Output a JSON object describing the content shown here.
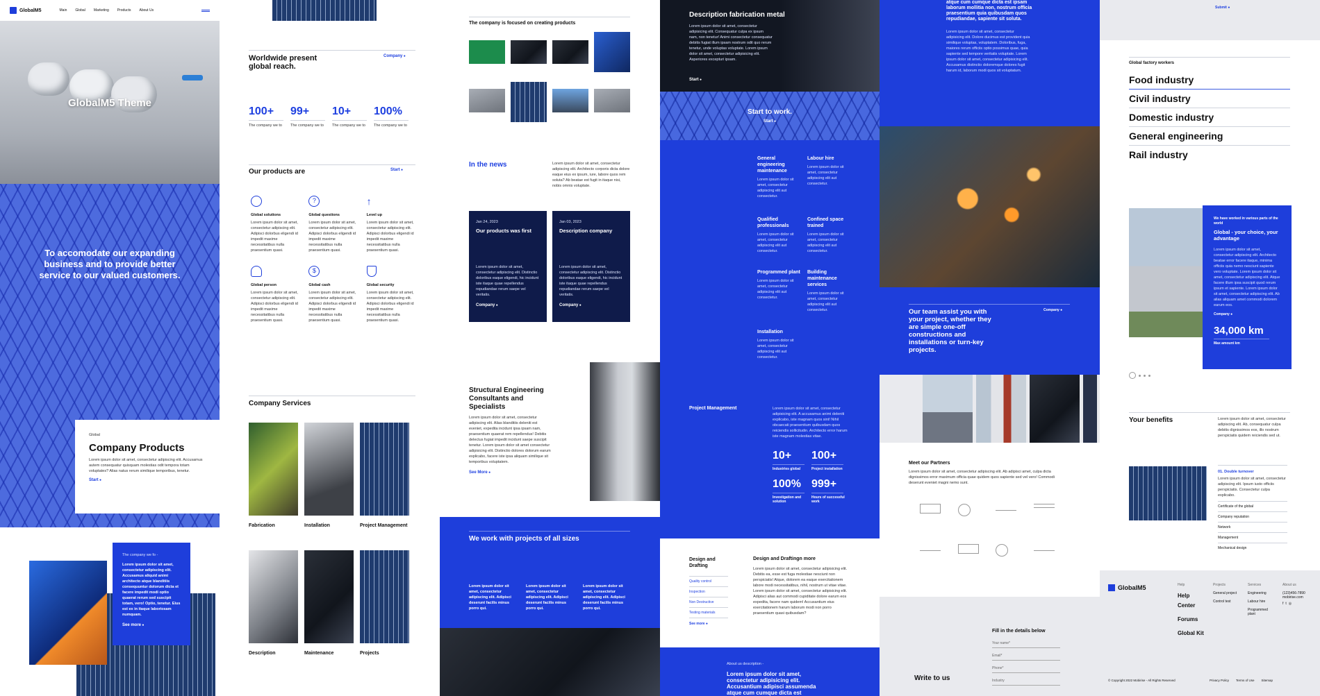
{
  "brand": "GlobalM5",
  "nav": [
    "Main",
    "Global",
    "Marketing",
    "Products",
    "About Us"
  ],
  "col1": {
    "hero_title": "GlobalM5 Theme",
    "tower_text": "To accomodate our expanding business and to provide better service to our valued customers.",
    "card_kicker": "Global",
    "card_title": "Company Products",
    "card_body": "Lorem ipsum dolor sit amet, consectetur adipiscing elit. Accusamus autem consequatur quisquam molestias odit tempora totam voluptates? Alias natus rerum similique temporibus, tenetur.",
    "card_link": "Start",
    "blue_kicker": "The company we fo -",
    "blue_body": "Lorem ipsum dolor sit amet, consectetur adipiscing elit. Accusamus aliquid animi architecto atque blanditiis consequuntur dolorum dicta et facere impedit modi optio quaerat rerum sed suscipit totam, vero! Optio, tenetur. Eius est ex in itaque laboriosam numquam.",
    "blue_link": "See more"
  },
  "col2": {
    "reach_title": "Worldwide present global reach.",
    "reach_link": "Company",
    "stats": [
      {
        "value": "100+",
        "label": "The company we to"
      },
      {
        "value": "99+",
        "label": "The company we to"
      },
      {
        "value": "10+",
        "label": "The company we to"
      },
      {
        "value": "100%",
        "label": "The company we to"
      }
    ],
    "products_title": "Our products are",
    "products_link": "Start",
    "products": [
      {
        "icon": "globe-icon",
        "title": "Global solutions"
      },
      {
        "icon": "question-icon",
        "title": "Global questions"
      },
      {
        "icon": "arrow-up-icon",
        "title": "Level up"
      },
      {
        "icon": "people-icon",
        "title": "Global person"
      },
      {
        "icon": "dollar-icon",
        "title": "Global cash"
      },
      {
        "icon": "shield-icon",
        "title": "Global security"
      }
    ],
    "product_body": "Lorem ipsum dolor sit amet, consectetur adipiscing elit. Adipisci dolorbus eligendi id impedit maxime necessitatibus nulla praesentium quasi.",
    "services_title": "Company Services",
    "services": [
      "Fabrication",
      "Installation",
      "Project Management",
      "Description",
      "Maintenance",
      "Projects"
    ]
  },
  "col3": {
    "focused_title": "The company is focused on creating products",
    "news_title": "In the news",
    "news_body": "Lorem ipsum dolor sit amet, consectetur adipiscing elit. Architecto corporis dicta dolore eaque eius ex ipsum, iure, labore quos rem soluta? Ab beatae est fugit in itaque nisi, nobis omnis voluptate.",
    "news_cards": [
      {
        "date": "Jan 24, 2023",
        "title": "Our products was first",
        "body": "Lorem ipsum dolor sit amet, consectetur adipiscing elit. Distinctio doloribus eaque eligendi, hic incidunt iste itaque quae repellendus repudiandae rerum saepe vel veritatis.",
        "link": "Company"
      },
      {
        "date": "Jan 03, 2023",
        "title": "Description company",
        "body": "Lorem ipsum dolor sit amet, consectetur adipiscing elit. Distinctio doloribus eaque eligendi, hic incidunt iste itaque quae repellendus repudiandae rerum saepe vel veritatis.",
        "link": "Company"
      }
    ],
    "struct_title": "Structural Engineering Consultants and Specialists",
    "struct_body": "Lorem ipsum dolor sit amet, consectetur adipiscing elit. Alias blanditiis deleniti est eveniet, expedita incidunt ipsa ipsam nam, praesentium quaerat rem repellendus! Debitis delectus fugiat impedit incidunt saepe suscipit tenetur. Lorem ipsum dolor sit amet consectetur adipisicing elit. Distinctio dolores dolorum earum explicabo, facere iste ipsa aliquam similique sit temporibus voluptatem.",
    "struct_link": "See More",
    "work_title": "We work with projects of all sizes",
    "work_cols": [
      "Lorem ipsum dolor sit amet, consectetur adipiscing elit. Adipisci deserunt facilis minus porro qui.",
      "Lorem ipsum dolor sit amet, consectetur adipiscing elit. Adipisci deserunt facilis minus porro qui.",
      "Lorem ipsum dolor sit amet, consectetur adipiscing elit. Adipisci deserunt facilis minus porro qui."
    ]
  },
  "col4": {
    "fab_title": "Description fabrication metal",
    "fab_body": "Lorem ipsum dolor sit amet, consectetur adipisicing elit. Consequatur culpa ex ipsum nam, non tenetur! Animi consectetur consequatur debitis fugiat illum ipsam nostrum odit quo rerum tenetur, unde voluptas voluptate. Lorem ipsum dolor sit amet, consectetur adipisicing elit. Asperiores excepturi ipsam.",
    "fab_link": "Start",
    "start_title": "Start to work.",
    "start_link": "Start",
    "services": [
      {
        "title": "General engineering maintenance",
        "body": "Lorem ipsum dolor sit amet, consectetur adipiscing elit aut consectetur."
      },
      {
        "title": "Labour hire",
        "body": "Lorem ipsum dolor sit amet, consectetur adipiscing elit aut consectetur."
      },
      {
        "title": "Qualified professionals",
        "body": "Lorem ipsum dolor sit amet, consectetur adipiscing elit aut consectetur."
      },
      {
        "title": "Confined space trained",
        "body": "Lorem ipsum dolor sit amet, consectetur adipiscing elit aut consectetur."
      },
      {
        "title": "Programmed plant",
        "body": "Lorem ipsum dolor sit amet, consectetur adipiscing elit aut consectetur."
      },
      {
        "title": "Building maintenance services",
        "body": "Lorem ipsum dolor sit amet, consectetur adipiscing elit aut consectetur."
      },
      {
        "title": "Installation",
        "body": "Lorem ipsum dolor sit amet, consectetur adipiscing elit aut consectetur."
      }
    ],
    "pm_title": "Project Management",
    "pm_body": "Lorem ipsum dolor sit amet, consectetur adipisicing elit. A accusamus animi deleniti explicabo, iste magnam quos sint! Nihil obcaecati praesentium quibusdam quos reiciendis sollicitudin. Architecto error harum iste magnam molestias vitae.",
    "stats": [
      {
        "value": "10+",
        "label": "Industries global"
      },
      {
        "value": "100+",
        "label": "Project installation"
      },
      {
        "value": "100%",
        "label": "Investigation and solution"
      },
      {
        "value": "999+",
        "label": "Hours of successful work"
      }
    ],
    "dd_left_title": "Design and Drafting",
    "dd_links": [
      "Quality control",
      "Inspection",
      "Non Destructive",
      "Testing materials"
    ],
    "dd_link": "See more",
    "dd_right_title": "Design and Draftingn more",
    "dd_body": "Lorem ipsum dolor sit amet, consectetur adipisicing elit. Debitis ea, esse est fuga molestiae nesciunt non perspiciatis! Atque, dolorem ea eaque exercitationem labore modi necessitatibus, nihil, nostrum ut vitae vitae. Lorem ipsum dolor sit amet, consectetur adipisicing elit. Adipisci alias aut commodi cupiditate dolore earum eos expedita, facere nam quidem! Accusantium eius exercitationem harum laborum modi non porro praesentium quasi quibusdam?",
    "about_kicker": "About us description -",
    "about_body": "Lorem ipsum dolor sit amet, consectetur adipisicing elit. Accusantium adipisci assumenda atque cum cumque dicta est"
  },
  "col5": {
    "top_text": "atque cum cumque dicta est ipsam laborum mollitia non, nostrum officia praesentium quia quibusdam quos repudiandae, sapiente sit soluta.",
    "top_body": "Lorem ipsum dolor sit amet, consectetur adipisicing elit. Dolore ducimus est provident quia similique voluptas, voluptatem. Doloribus, fuga, maiores rerum officiis optio possimus quae, quia sapiente sed tempore veritatis voluptate. Lorem ipsum dolor sit amet, consectetur adipisicing elit. Accusamus distinctio doloremque dolores fugit harum id, laborum modi quos sit voluptatum.",
    "team_text": "Our team assist you with your project, whether they are simple one-off constructions and installations or turn-key projects.",
    "team_link": "Company",
    "partners_title": "Meet our Partners",
    "partners_body": "Lorem ipsum dolor sit amet, consectetur adipiscing elit. Ab adipisci amet, culpa dicta dignissimos error maximum officia quae quidem quos sapiente sed vel vero! Commodi deserunt eveniet magni nemo sunt.",
    "form_title": "Fill in the details below",
    "form_fields": [
      "Your name*",
      "Email*",
      "Phone*",
      "Industry"
    ],
    "write_title": "Write to us"
  },
  "col6": {
    "submit": "Submit",
    "workers_kicker": "Global factory workers",
    "industries": [
      "Food industry",
      "Civil industry",
      "Domestic industry",
      "General engineering",
      "Rail industry"
    ],
    "blue_kicker": "We have worked in various parts of the world",
    "blue_title": "Global - your choice, your advantage",
    "blue_body": "Lorem ipsum dolor sit amet, consectetur adipiscing elit. Architecto beatae error facere itaque, minima officiis quia nemo nesciunt sapiente vero voluptate. Lorem ipsum dolor sit amet, consectetur adipiscing elit. Atque facere illum ipsa suscipit quod rerum ipsum et sapiente. Lorem ipsum dolor sit amet, consectetur adipiscing elit. Ab alias aliquam amet commodi dolorem earum eos.",
    "blue_link": "Company",
    "km_value": "34,000 km",
    "km_label": "Max amount km",
    "benefits_title": "Your benefits",
    "benefits_body": "Lorem ipsum dolor sit amet, consectetur adipiscing elit. Ab, consequatur culpa debitis dignissimos eos, illo nostrum perspiciatis quidem reiciendis sed ut.",
    "benefit_item_title": "01. Double turnover",
    "benefit_item_body": "Lorem ipsum dolor sit amet, consectetur adipiscing elit. Ipsum iusto officiis perspiciatis. Consectetur culpa explicabo.",
    "benefit_links": [
      "Certificate of the global",
      "Company reputation",
      "Network",
      "Management",
      "Mechanical design"
    ],
    "footer_brand": "GlobalM5",
    "footer_help": [
      "Help",
      "Center",
      "Forums",
      "Global Kit"
    ],
    "footer_cols": [
      {
        "head": "Help",
        "items": []
      },
      {
        "head": "Projects",
        "items": [
          "General project",
          "Control test"
        ]
      },
      {
        "head": "Services",
        "items": [
          "Engineering",
          "Labour hire",
          "Programmed plant"
        ]
      },
      {
        "head": "About us",
        "items": [
          "(123)456-7890",
          "mobirise.com"
        ]
      }
    ],
    "copyright": "© Copyright 2022 Mobirise - All Rights Reserved",
    "legal": [
      "Privacy Policy",
      "Terms of Use",
      "Sitemap"
    ]
  },
  "colors": {
    "accent": "#1e3edb",
    "navy": "#0f1b4a",
    "light_bg": "#e9eaee"
  }
}
